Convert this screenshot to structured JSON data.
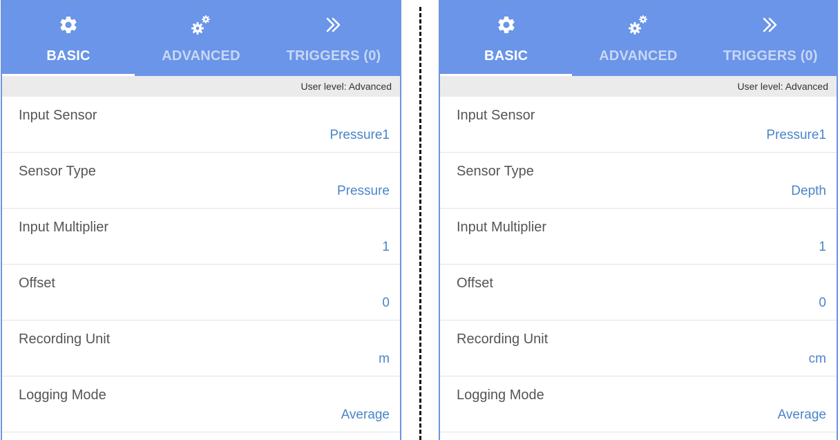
{
  "panels": [
    {
      "tabs": [
        {
          "label": "BASIC",
          "icon": "gear-icon"
        },
        {
          "label": "ADVANCED",
          "icon": "gears-icon"
        },
        {
          "label": "TRIGGERS (0)",
          "icon": "double-chevron-right-icon"
        }
      ],
      "active_tab": "BASIC",
      "user_level": "User level: Advanced",
      "settings": [
        {
          "label": "Input Sensor",
          "value": "Pressure1"
        },
        {
          "label": "Sensor Type",
          "value": "Pressure"
        },
        {
          "label": "Input Multiplier",
          "value": "1"
        },
        {
          "label": "Offset",
          "value": "0"
        },
        {
          "label": "Recording Unit",
          "value": "m"
        },
        {
          "label": "Logging Mode",
          "value": "Average"
        }
      ]
    },
    {
      "tabs": [
        {
          "label": "BASIC",
          "icon": "gear-icon"
        },
        {
          "label": "ADVANCED",
          "icon": "gears-icon"
        },
        {
          "label": "TRIGGERS (0)",
          "icon": "double-chevron-right-icon"
        }
      ],
      "active_tab": "BASIC",
      "user_level": "User level: Advanced",
      "settings": [
        {
          "label": "Input Sensor",
          "value": "Pressure1"
        },
        {
          "label": "Sensor Type",
          "value": "Depth"
        },
        {
          "label": "Input Multiplier",
          "value": "1"
        },
        {
          "label": "Offset",
          "value": "0"
        },
        {
          "label": "Recording Unit",
          "value": "cm"
        },
        {
          "label": "Logging Mode",
          "value": "Average"
        }
      ]
    }
  ],
  "colors": {
    "header": "#6a95e8",
    "value_text": "#4a84c9",
    "label_text": "#555555",
    "user_level_bar": "#ebebeb"
  }
}
